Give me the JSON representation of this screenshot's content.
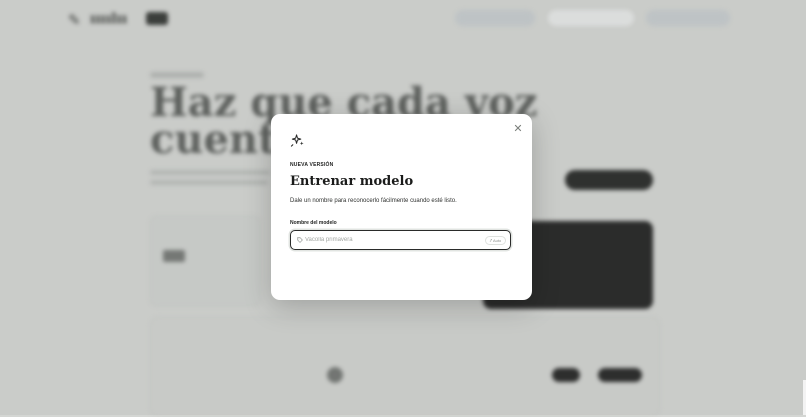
{
  "modal": {
    "close_icon": "close-icon",
    "icon": "sparkles-icon",
    "eyebrow": "NUEVA VERSIÓN",
    "title": "Entrenar modelo",
    "description": "Dale un nombre para reconocerlo fácilmente cuando esté listo.",
    "field": {
      "label": "Nombre del modelo",
      "icon": "tag-icon",
      "value": "",
      "placeholder": "Vacolla primavera",
      "auto_button": {
        "label": "Auto",
        "icon": "wand-icon"
      }
    }
  },
  "background": {
    "headline_line1": "Haz que cada voz",
    "headline_line2": "cuente"
  },
  "colors": {
    "backdrop": "#d4d6d3",
    "modal_bg": "#ffffff",
    "field_border": "#2a2b2a",
    "dark_accent": "#2d2e2d"
  }
}
